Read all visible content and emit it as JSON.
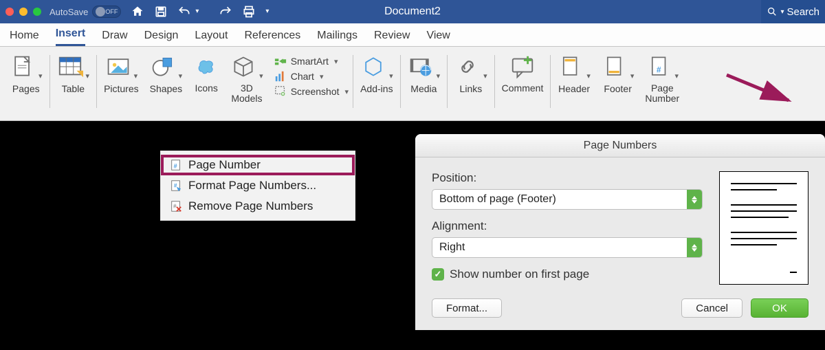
{
  "titlebar": {
    "autosave_label": "AutoSave",
    "autosave_state": "OFF",
    "doc_title": "Document2",
    "search_label": "Search"
  },
  "tabs": {
    "items": [
      "Home",
      "Insert",
      "Draw",
      "Design",
      "Layout",
      "References",
      "Mailings",
      "Review",
      "View"
    ],
    "active_index": 1
  },
  "ribbon": {
    "pages": "Pages",
    "table": "Table",
    "pictures": "Pictures",
    "shapes": "Shapes",
    "icons": "Icons",
    "models3d": "3D\nModels",
    "smartart": "SmartArt",
    "chart": "Chart",
    "screenshot": "Screenshot",
    "addins": "Add-ins",
    "media": "Media",
    "links": "Links",
    "comment": "Comment",
    "header": "Header",
    "footer": "Footer",
    "pagenumber": "Page\nNumber"
  },
  "menu": {
    "item1": "Page Number",
    "item2": "Format Page Numbers...",
    "item3": "Remove Page Numbers"
  },
  "dialog": {
    "title": "Page Numbers",
    "position_label": "Position:",
    "position_value": "Bottom of page (Footer)",
    "alignment_label": "Alignment:",
    "alignment_value": "Right",
    "show_first_page": "Show number on first page",
    "format_btn": "Format...",
    "cancel_btn": "Cancel",
    "ok_btn": "OK"
  }
}
